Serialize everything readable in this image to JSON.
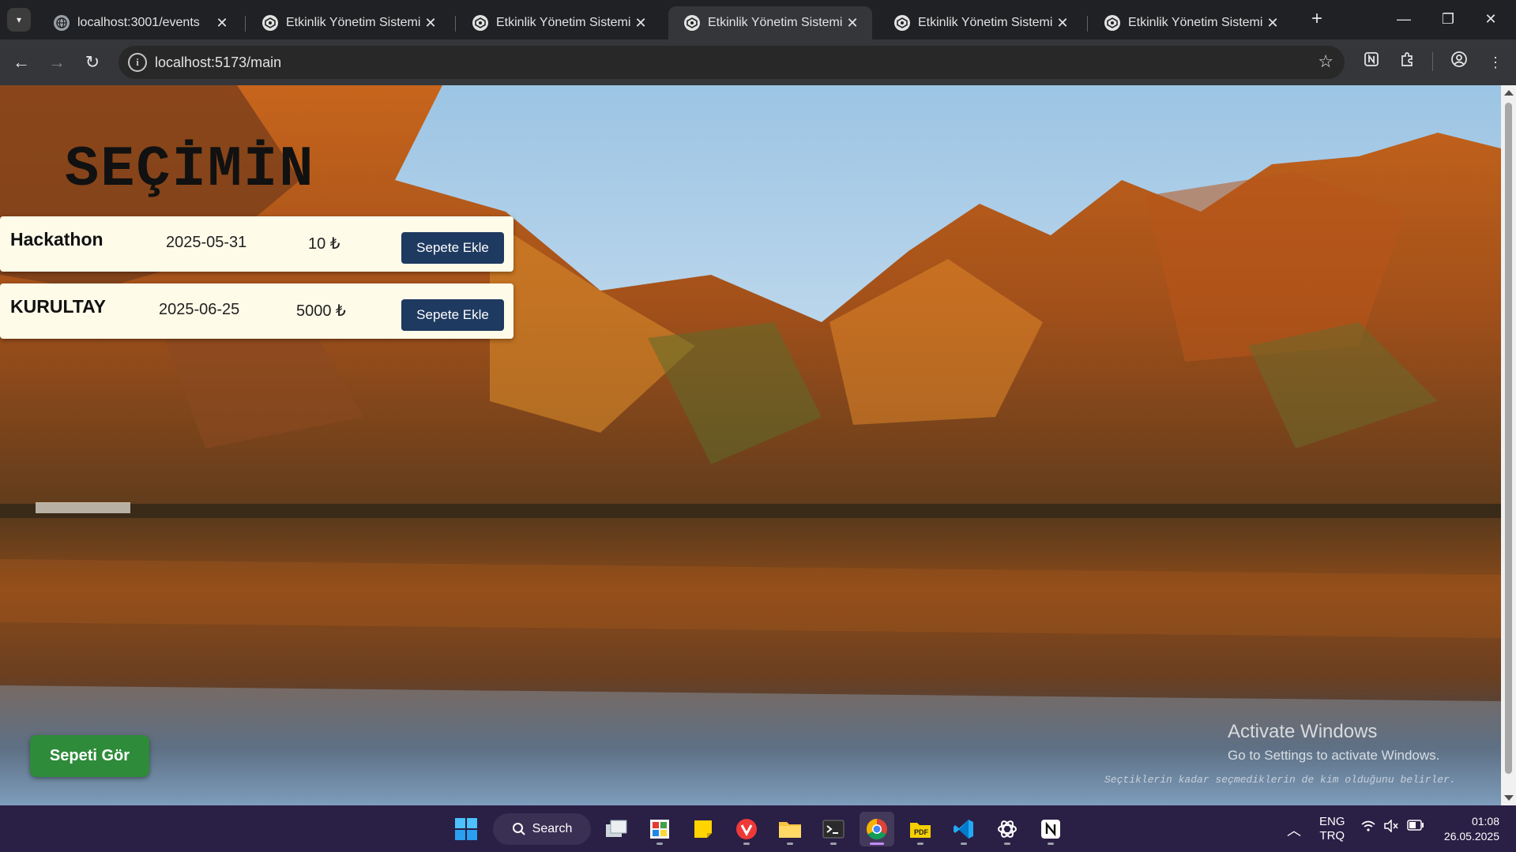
{
  "browser": {
    "tabs": [
      {
        "title": "localhost:3001/events",
        "active": false
      },
      {
        "title": "Etkinlik Yönetim Sistemi",
        "active": false
      },
      {
        "title": "Etkinlik Yönetim Sistemi",
        "active": false
      },
      {
        "title": "Etkinlik Yönetim Sistemi",
        "active": true
      },
      {
        "title": "Etkinlik Yönetim Sistemi",
        "active": false
      },
      {
        "title": "Etkinlik Yönetim Sistemi",
        "active": false
      }
    ],
    "url": "localhost:5173/main"
  },
  "page": {
    "title": "SEÇİMİN",
    "events": [
      {
        "name": "Hackathon",
        "date": "2025-05-31",
        "price": "10 ₺",
        "button": "Sepete Ekle"
      },
      {
        "name": "KURULTAY",
        "date": "2025-06-25",
        "price": "5000 ₺",
        "button": "Sepete Ekle"
      }
    ],
    "cart_button": "Sepeti Gör",
    "quote": "Seçtiklerin kadar seçmediklerin de kim olduğunu belirler."
  },
  "watermark": {
    "title": "Activate Windows",
    "subtitle": "Go to Settings to activate Windows."
  },
  "taskbar": {
    "search_label": "Search",
    "lang_top": "ENG",
    "lang_bottom": "TRQ",
    "time": "01:08",
    "date": "26.05.2025"
  },
  "colors": {
    "button_blue": "#1f3a60",
    "cart_green": "#2e8b3a",
    "card_bg": "#fffbe9"
  }
}
